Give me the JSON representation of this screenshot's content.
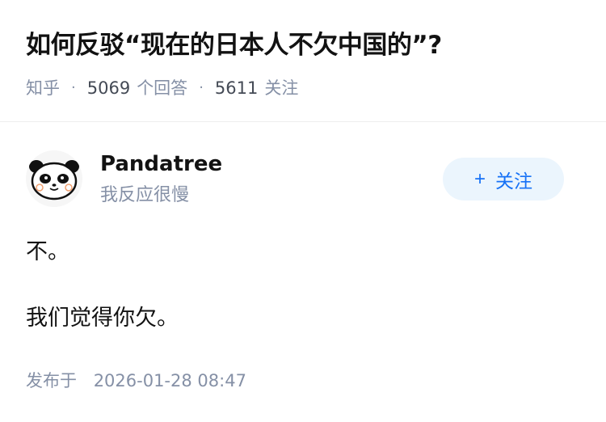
{
  "question": {
    "title": "如何反驳“现在的日本人不欠中国的”?",
    "site": "知乎",
    "answer_count": "5069",
    "answer_label": "个回答",
    "follower_count": "5611",
    "follower_label": "关注"
  },
  "author": {
    "name": "Pandatree",
    "bio": "我反应很慢",
    "avatar_icon": "panda-avatar-icon",
    "follow_label": "关注",
    "follow_icon": "plus-icon"
  },
  "answer": {
    "paragraphs": [
      "不。",
      "我们觉得你欠。"
    ],
    "published_label": "发布于",
    "published_time": "2026-01-28 08:47"
  },
  "colors": {
    "accent": "#1772f6",
    "accent_bg": "#ebf5fd",
    "meta_gray": "#8590a6",
    "text": "#121212"
  }
}
